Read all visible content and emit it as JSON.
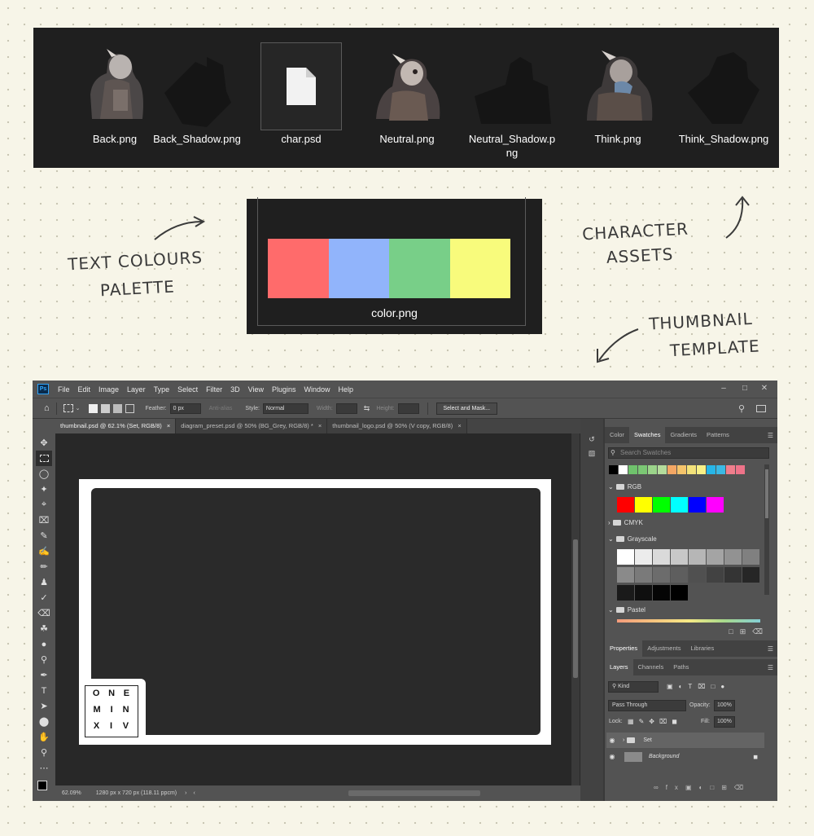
{
  "files": [
    {
      "name": "Back.png",
      "kind": "character"
    },
    {
      "name": "Back_Shadow.png",
      "kind": "shadow"
    },
    {
      "name": "char.psd",
      "kind": "document",
      "selected": true
    },
    {
      "name": "Neutral.png",
      "kind": "character"
    },
    {
      "name": "Neutral_Shadow.png",
      "kind": "shadow"
    },
    {
      "name": "Think.png",
      "kind": "character"
    },
    {
      "name": "Think_Shadow.png",
      "kind": "shadow"
    }
  ],
  "color_file": {
    "name": "color.png",
    "colors": [
      "#ff6b6b",
      "#91b4fb",
      "#78cf88",
      "#f8fb7c"
    ]
  },
  "annotations": {
    "text_colours_line1": "Text Colours",
    "text_colours_line2": "Palette",
    "character_line1": "Character",
    "character_line2": "Assets",
    "thumbnail_line1": "Thumbnail",
    "thumbnail_line2": "Template"
  },
  "photoshop": {
    "menus": [
      "File",
      "Edit",
      "Image",
      "Layer",
      "Type",
      "Select",
      "Filter",
      "3D",
      "View",
      "Plugins",
      "Window",
      "Help"
    ],
    "options": {
      "feather_label": "Feather:",
      "feather_value": "0 px",
      "anti_alias": "Anti-alias",
      "style_label": "Style:",
      "style_value": "Normal",
      "width_label": "Width:",
      "height_label": "Height:",
      "select_mask": "Select and Mask..."
    },
    "tabs": [
      "thumbnail.psd @ 62.1% (Set, RGB/8)",
      "diagram_preset.psd @ 50% (BG_Grey, RGB/8) *",
      "thumbnail_logo.psd @ 50% (V copy, RGB/8)"
    ],
    "logo_rows": [
      [
        "O",
        "N",
        "E"
      ],
      [
        "M",
        "I",
        "N"
      ],
      [
        "X",
        "I",
        "V"
      ]
    ],
    "status": {
      "zoom": "62.09%",
      "size": "1280 px x 720 px (118.11 ppcm)"
    },
    "color_panel": {
      "tabs": [
        "Color",
        "Swatches",
        "Gradients",
        "Patterns"
      ],
      "search_placeholder": "Search Swatches",
      "recent": [
        "#000000",
        "#ffffff",
        "#6fc26c",
        "#7bc774",
        "#9bd48a",
        "#b4dc9c",
        "#f4a764",
        "#f5c46b",
        "#f3e27a",
        "#f8f087",
        "#27b6e8",
        "#3bb9e4",
        "#f07e8c",
        "#ee7389"
      ],
      "groups": {
        "rgb": "RGB",
        "cmyk": "CMYK",
        "grayscale": "Grayscale",
        "pastel": "Pastel"
      },
      "rgb_colors": [
        "#ff0000",
        "#ffff00",
        "#00ff00",
        "#00ffff",
        "#0000ff",
        "#ff00ff"
      ],
      "gray_colors": [
        "#ffffff",
        "#ececec",
        "#dadada",
        "#c8c8c8",
        "#b6b6b6",
        "#a4a4a4",
        "#929292",
        "#808080",
        "#8a8a8a",
        "#7a7a7a",
        "#6c6c6c",
        "#5e5e5e",
        "#505050",
        "#424242",
        "#343434",
        "#262626",
        "#1a1a1a",
        "#0f0f0f",
        "#050505",
        "#000000"
      ]
    },
    "properties_tabs": [
      "Properties",
      "Adjustments",
      "Libraries"
    ],
    "layers_panel": {
      "tabs": [
        "Layers",
        "Channels",
        "Paths"
      ],
      "kind": "Kind",
      "blend": "Pass Through",
      "opacity_label": "Opacity:",
      "opacity_value": "100%",
      "lock_label": "Lock:",
      "fill_label": "Fill:",
      "fill_value": "100%",
      "layers": [
        "Set",
        "Background"
      ]
    }
  }
}
